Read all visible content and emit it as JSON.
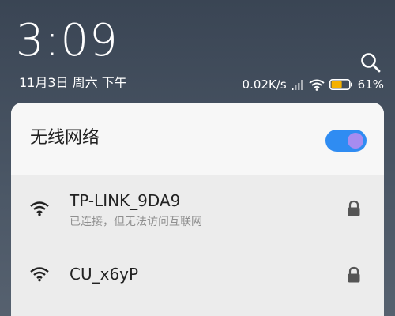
{
  "status": {
    "time": "3:09",
    "date": "11月3日 周六 下午",
    "net_speed": "0.02K/s",
    "battery_percent": "61%",
    "battery_level": 0.61
  },
  "wifi_panel": {
    "title": "无线网络",
    "toggle_on": true,
    "accent_color": "#2f8cf2",
    "networks": [
      {
        "ssid": "TP-LINK_9DA9",
        "status": "已连接，但无法访问互联网",
        "secured": true
      },
      {
        "ssid": "CU_x6yP",
        "status": "",
        "secured": true
      }
    ]
  },
  "icons": {
    "search": "search-icon",
    "signal": "cell-signal-icon",
    "wifi_status": "wifi-icon",
    "battery": "battery-icon",
    "network": "wifi-signal-icon",
    "lock": "lock-icon"
  }
}
